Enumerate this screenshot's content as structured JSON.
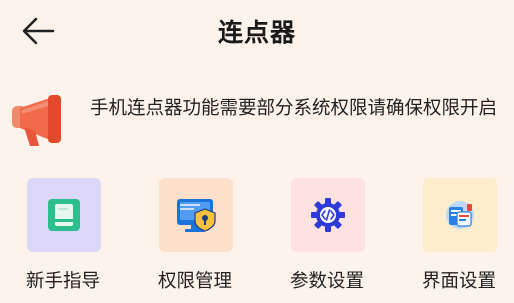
{
  "header": {
    "title": "连点器",
    "back_icon": "arrow-left-icon"
  },
  "notice": {
    "icon": "megaphone-icon",
    "text": "手机连点器功能需要部分系统权限请确保权限开启"
  },
  "tiles": [
    {
      "label": "新手指导",
      "icon": "book-icon",
      "bg": "#dcd6f7",
      "accent": "#2bbf8e"
    },
    {
      "label": "权限管理",
      "icon": "monitor-lock-icon",
      "bg": "#fde0cb",
      "accent": "#1a73d9"
    },
    {
      "label": "参数设置",
      "icon": "gear-code-icon",
      "bg": "#fde2e0",
      "accent": "#2f3bd9"
    },
    {
      "label": "界面设置",
      "icon": "interface-icon",
      "bg": "#fdedcc",
      "accent": "#2a7fe0"
    }
  ],
  "colors": {
    "background": "#fdf3ea",
    "megaphone": "#e8573c"
  }
}
